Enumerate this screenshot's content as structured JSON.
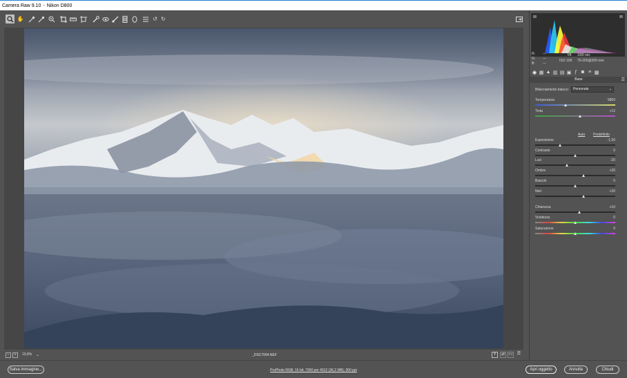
{
  "window": {
    "app": "Camera Raw 9.10",
    "separator": "-",
    "camera": "Nikon D800"
  },
  "toolbar": {
    "tools": [
      {
        "name": "zoom-tool",
        "icon": "zoom-icon",
        "active": true
      },
      {
        "name": "hand-tool",
        "icon": "hand-icon",
        "active": false
      },
      {
        "name": "white-balance-tool",
        "icon": "eyedropper-icon",
        "active": false
      },
      {
        "name": "color-sampler-tool",
        "icon": "color-sampler-icon",
        "active": false
      },
      {
        "name": "targeted-adjustment-tool",
        "icon": "target-adjust-icon",
        "active": false
      },
      {
        "name": "crop-tool",
        "icon": "crop-icon",
        "active": false
      },
      {
        "name": "straighten-tool",
        "icon": "straighten-icon",
        "active": false
      },
      {
        "name": "transform-tool",
        "icon": "transform-icon",
        "active": false
      },
      {
        "name": "spot-removal-tool",
        "icon": "spot-removal-icon",
        "active": false
      },
      {
        "name": "red-eye-tool",
        "icon": "red-eye-icon",
        "active": false
      },
      {
        "name": "adjustment-brush-tool",
        "icon": "brush-icon",
        "active": false
      },
      {
        "name": "graduated-filter-tool",
        "icon": "graduated-filter-icon",
        "active": false
      },
      {
        "name": "radial-filter-tool",
        "icon": "radial-filter-icon",
        "active": false
      },
      {
        "name": "preferences-tool",
        "icon": "list-icon",
        "active": false
      },
      {
        "name": "rotate-left-tool",
        "icon": "rotate-left-icon",
        "active": false
      },
      {
        "name": "rotate-right-tool",
        "icon": "rotate-right-icon",
        "active": false
      }
    ],
    "fullscreen_icon": "fullscreen-icon"
  },
  "status": {
    "zoom": "19,8%",
    "filename": "_DSC7004.NEF",
    "view_y_label": "Y"
  },
  "readout": {
    "r_label": "R:",
    "g_label": "G:",
    "b_label": "B:",
    "r_value": "---",
    "g_value": "---",
    "b_value": "---",
    "aperture": "f/8",
    "shutter": "1/80 sec",
    "iso": "ISO 100",
    "lens": "70-200@200 mm"
  },
  "panel": {
    "title": "Base",
    "wb_label": "Bilanciamento bianco:",
    "wb_value": "Personale",
    "auto_label": "Auto",
    "default_label": "Predefinito",
    "sliders": [
      {
        "label": "Temperatura",
        "value": "5800",
        "position": 0.38,
        "gradient": "temp"
      },
      {
        "label": "Tinta",
        "value": "+12",
        "position": 0.56,
        "gradient": "tint"
      },
      {
        "label": "Esposizione",
        "value": "-1,90",
        "position": 0.31,
        "gradient": "none"
      },
      {
        "label": "Contrasto",
        "value": "0",
        "position": 0.5,
        "gradient": "none"
      },
      {
        "label": "Luci",
        "value": "-20",
        "position": 0.4,
        "gradient": "none"
      },
      {
        "label": "Ombre",
        "value": "+20",
        "position": 0.6,
        "gradient": "none"
      },
      {
        "label": "Bianchi",
        "value": "0",
        "position": 0.5,
        "gradient": "none"
      },
      {
        "label": "Neri",
        "value": "+20",
        "position": 0.6,
        "gradient": "none"
      },
      {
        "label": "Chiarezza",
        "value": "+10",
        "position": 0.55,
        "gradient": "none"
      },
      {
        "label": "Vividezza",
        "value": "0",
        "position": 0.5,
        "gradient": "sat"
      },
      {
        "label": "Saturazione",
        "value": "0",
        "position": 0.5,
        "gradient": "sat"
      }
    ]
  },
  "bottom": {
    "save_label": "Salva immagine...",
    "workflow": "ProPhoto RGB; 16 bit; 7360 per 4912 (36,2 MB); 300 ppi",
    "open_label": "Apri oggetto",
    "cancel_label": "Annulla",
    "close_label": "Chiudi"
  }
}
